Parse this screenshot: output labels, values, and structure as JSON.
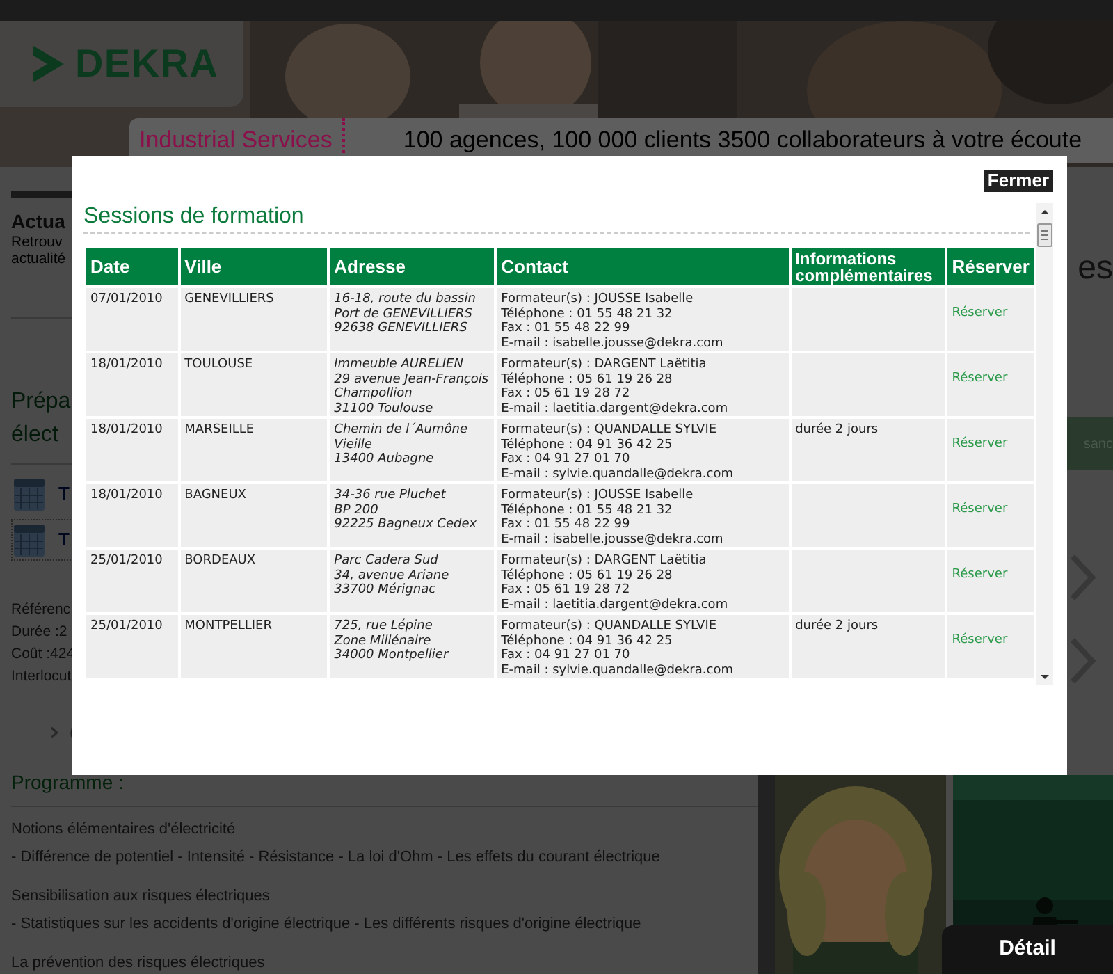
{
  "banner": {
    "logo": "DEKRA",
    "division": "Industrial Services",
    "slogan": "100 agences, 100 000 clients 3500 collaborateurs à votre écoute"
  },
  "news": {
    "title": "Actua",
    "lines": [
      "Retrouv",
      "actualité"
    ]
  },
  "course": {
    "title_lines": [
      "Prépa",
      "élect"
    ],
    "links": [
      {
        "label": "T",
        "framed": false
      },
      {
        "label": "T",
        "framed": true
      }
    ],
    "details": [
      "Référenc",
      "Durée :2",
      "Coût :424",
      "Interlocut"
    ],
    "more": "("
  },
  "programme": {
    "title": "Programme :",
    "sections": [
      {
        "heading": "Notions élémentaires d'électricité",
        "text": "- Différence de potentiel - Intensité - Résistance - La loi d'Ohm - Les effets du courant électrique"
      },
      {
        "heading": "Sensibilisation aux risques électriques",
        "text": "- Statistiques sur les accidents d'origine électrique - Les différents risques d'origine électrique"
      },
      {
        "heading": "La prévention des risques électriques"
      }
    ]
  },
  "side": {
    "heading_end": "es",
    "band_text": "sanc"
  },
  "detail_button": "Détail",
  "modal": {
    "close": "Fermer",
    "title": "Sessions de formation",
    "columns": [
      "Date",
      "Ville",
      "Adresse",
      "Contact",
      "Informations complémentaires",
      "Réserver"
    ],
    "rows": [
      {
        "date": "07/01/2010",
        "city": "GENEVILLIERS",
        "address": [
          "16-18, route du bassin",
          "Port de GENEVILLIERS",
          "92638 GENEVILLIERS"
        ],
        "contact": [
          "Formateur(s) : JOUSSE Isabelle",
          "Téléphone : 01 55 48 21 32",
          "Fax : 01 55 48 22 99",
          "E-mail : isabelle.jousse@dekra.com"
        ],
        "action": "Réserver"
      },
      {
        "date": "18/01/2010",
        "city": "TOULOUSE",
        "address": [
          "Immeuble AURELIEN",
          "29 avenue Jean-François",
          "Champollion",
          "31100 Toulouse"
        ],
        "contact": [
          "Formateur(s) : DARGENT Laëtitia",
          "Téléphone : 05 61 19 26 28",
          "Fax : 05 61 19 28 72",
          "E-mail : laetitia.dargent@dekra.com"
        ],
        "action": "Réserver"
      },
      {
        "date": "18/01/2010",
        "city": "MARSEILLE",
        "address": [
          "Chemin de l´Aumône",
          "Vieille",
          "13400 Aubagne"
        ],
        "contact": [
          "Formateur(s) : QUANDALLE SYLVIE",
          "Téléphone : 04 91 36 42 25",
          "Fax : 04 91 27 01 70",
          "E-mail : sylvie.quandalle@dekra.com"
        ],
        "info": "durée 2 jours",
        "action": "Réserver"
      },
      {
        "date": "18/01/2010",
        "city": "BAGNEUX",
        "address": [
          "34-36 rue Pluchet",
          "BP 200",
          "92225 Bagneux Cedex"
        ],
        "contact": [
          "Formateur(s) : JOUSSE Isabelle",
          "Téléphone : 01 55 48 21 32",
          "Fax : 01 55 48 22 99",
          "E-mail : isabelle.jousse@dekra.com"
        ],
        "action": "Réserver"
      },
      {
        "date": "25/01/2010",
        "city": "BORDEAUX",
        "address": [
          "Parc Cadera Sud",
          "34, avenue Ariane",
          "33700 Mérignac"
        ],
        "contact": [
          "Formateur(s) : DARGENT Laëtitia",
          "Téléphone : 05 61 19 26 28",
          "Fax : 05 61 19 28 72",
          "E-mail : laetitia.dargent@dekra.com"
        ],
        "action": "Réserver"
      },
      {
        "date": "25/01/2010",
        "city": "MONTPELLIER",
        "address": [
          "725, rue Lépine",
          "Zone Millénaire",
          "34000 Montpellier"
        ],
        "contact": [
          "Formateur(s) : QUANDALLE SYLVIE",
          "Téléphone : 04 91 36 42 25",
          "Fax : 04 91 27 01 70",
          "E-mail : sylvie.quandalle@dekra.com"
        ],
        "info": "durée 2 jours",
        "action": "Réserver"
      }
    ]
  }
}
